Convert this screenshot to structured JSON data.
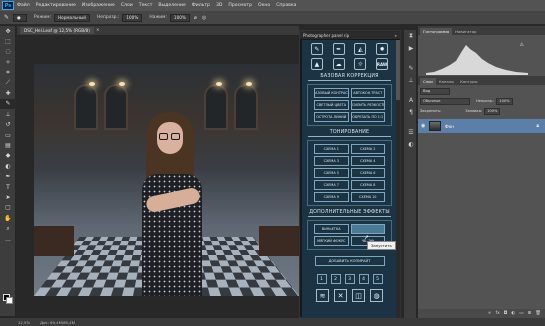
{
  "menubar": {
    "logo": "Ps",
    "items": [
      "Файл",
      "Редактирование",
      "Изображение",
      "Слои",
      "Текст",
      "Выделение",
      "Фильтр",
      "3D",
      "Просмотр",
      "Окно",
      "Справка"
    ]
  },
  "options": {
    "mode_label": "Режим:",
    "mode_value": "Нормальный",
    "opacity_label": "Непрозр.:",
    "opacity_value": "100%",
    "pressure_label": "Нажим:",
    "pressure_value": "100%"
  },
  "document": {
    "tab_title": "DSC_Hel.Leaf @ 12,5% (RGB/8)",
    "close": "×"
  },
  "plugin": {
    "title": "Photographer panel rip",
    "title_close": "»",
    "icons": [
      "brush-icon",
      "pen-icon",
      "fill-icon",
      "sun-icon",
      "mountain-icon",
      "cloud-icon",
      "sun-outline-icon"
    ],
    "raw_label": "RAW",
    "sections": {
      "basic": {
        "title": "БАЗОВАЯ КОРРЕКЦИЯ",
        "buttons": [
          "БАЗОВЫЙ КОНТРАСТ",
          "АВТОКОН.ТРАСТ",
          "СВЕТЛЫЙ ЦВЕТА",
          "УСИЛИТЬ РЕЗКОСТЬ",
          "ОСТРОТА ЛИНИЙ",
          "ОБРЕЗАТЬ ПО 1:1"
        ]
      },
      "toning": {
        "title": "ТОНИРОВАНИЕ",
        "buttons": [
          "СХЕМА 1",
          "СХЕМА 2",
          "СХЕМА 3",
          "СХЕМА 4",
          "СХЕМА 5",
          "СХЕМА 6",
          "СХЕМА 7",
          "СХЕМА 8",
          "СХЕМА 9",
          "СХЕМА 10"
        ]
      },
      "extra": {
        "title": "ДОПОЛНИТЕЛЬНЫЕ ЭФФЕКТЫ",
        "buttons": [
          "ВИНЬЕТКА",
          "",
          "МЯГКИЙ ФОКУС",
          "ЧБ. ЭФ"
        ]
      }
    },
    "add_copyright": "ДОБАВИТЬ КОПИРАЙТ",
    "numbers": [
      "1",
      "2",
      "3",
      "4",
      "5"
    ],
    "bottom_icons": [
      "layers-icon",
      "crosshair-icon",
      "frame-icon",
      "globe-icon"
    ],
    "tooltip": "Запустить"
  },
  "right_panel": {
    "tabs_top": [
      "Гистограмма",
      "Навигатор"
    ],
    "tabs_layers": [
      "Слои",
      "Каналы",
      "Контуры"
    ],
    "kind_label": "Вид",
    "blend_value": "Обычные",
    "opacity_label": "Непрозр.:",
    "opacity_value": "100%",
    "lock_label": "Закрепить:",
    "fill_label": "Заливка:",
    "fill_value": "100%",
    "layer_name": "Фон"
  },
  "status": {
    "zoom": "12,5%",
    "doc_size": "Док: 69,4M/69,4M"
  }
}
